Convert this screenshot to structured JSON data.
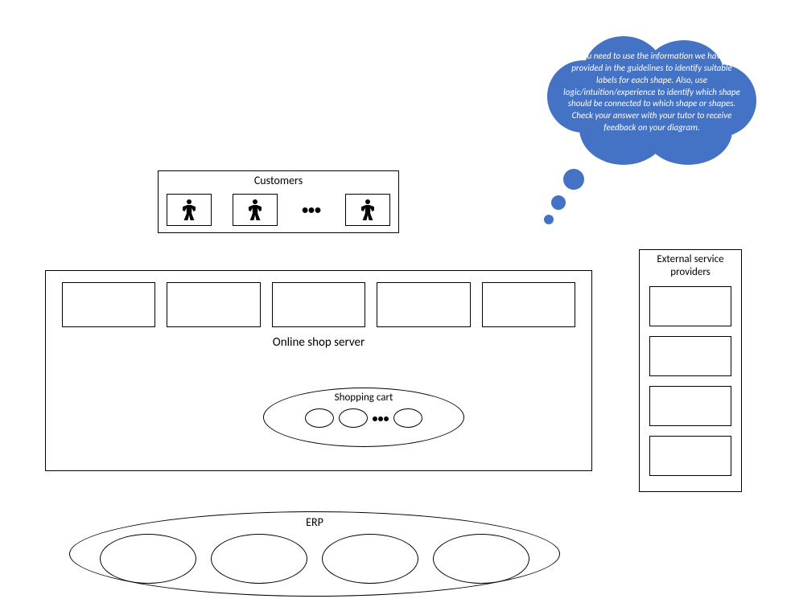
{
  "thought_bubble": {
    "text": "You need to use the information we have provided in the guidelines to identify suitable labels for each shape. Also, use logic/intuition/experience to identify which shape should be connected to which shape or shapes. Check your answer with your tutor to receive feedback on your diagram."
  },
  "customers": {
    "title": "Customers",
    "ellipsis": "•••"
  },
  "server": {
    "title": "Online shop server",
    "service_boxes_count": 5,
    "cart": {
      "title": "Shopping cart",
      "items_count": 3,
      "ellipsis": "•••"
    }
  },
  "external": {
    "title": "External service providers",
    "boxes_count": 4
  },
  "erp": {
    "title": "ERP",
    "items_count": 4
  }
}
